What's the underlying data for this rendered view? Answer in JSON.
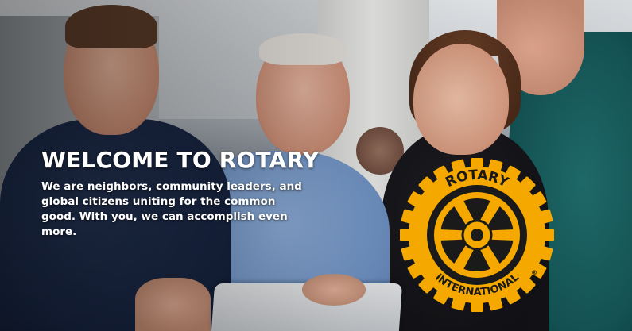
{
  "hero": {
    "headline": "WELCOME TO ROTARY",
    "tagline": "We are neighbors, community leaders, and global citizens uniting for the common good. With you, we can accomplish even more."
  },
  "logo": {
    "top_text": "ROTARY",
    "bottom_text": "INTERNATIONAL",
    "registered_mark": "®",
    "gold_color": "#f5a800",
    "dark_color": "#1a1a1a"
  }
}
